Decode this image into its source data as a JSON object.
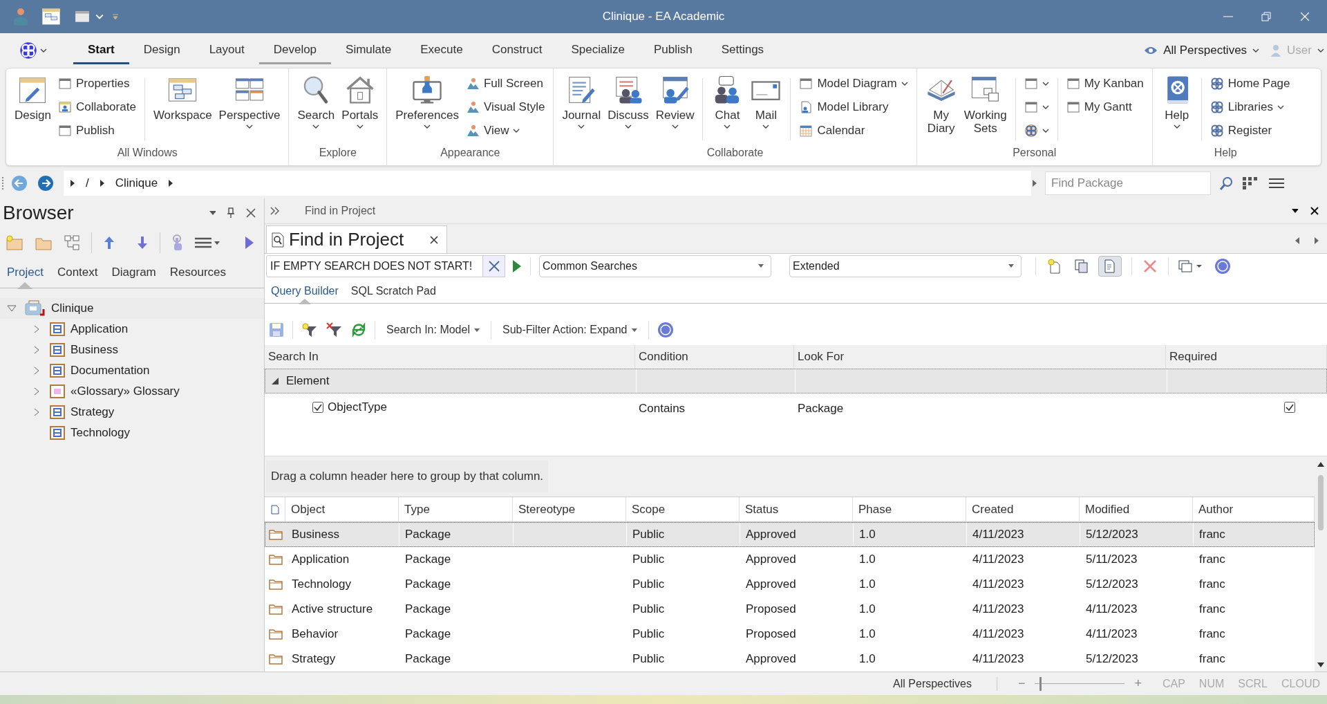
{
  "window": {
    "title": "Clinique - EA Academic"
  },
  "ribbon_tabs": [
    {
      "label": "Start",
      "selected": true,
      "underlined": true
    },
    {
      "label": "Design",
      "selected": false,
      "underlined": false
    },
    {
      "label": "Layout",
      "selected": false,
      "underlined": false
    },
    {
      "label": "Develop",
      "selected": false,
      "underlined": true
    },
    {
      "label": "Simulate",
      "selected": false,
      "underlined": false
    },
    {
      "label": "Execute",
      "selected": false,
      "underlined": false
    },
    {
      "label": "Construct",
      "selected": false,
      "underlined": false
    },
    {
      "label": "Specialize",
      "selected": false,
      "underlined": false
    },
    {
      "label": "Publish",
      "selected": false,
      "underlined": false
    },
    {
      "label": "Settings",
      "selected": false,
      "underlined": false
    }
  ],
  "perspective": {
    "label": "All Perspectives"
  },
  "user": {
    "label": "User",
    "disabled": true
  },
  "ribbon_groups": [
    {
      "label": "All Windows",
      "items": [
        {
          "kind": "large",
          "label": "Design",
          "dropdown": false
        },
        {
          "kind": "stack",
          "items": [
            {
              "label": "Properties",
              "dropdown": false
            },
            {
              "label": "Collaborate",
              "dropdown": false
            },
            {
              "label": "Publish",
              "dropdown": false
            }
          ]
        },
        {
          "kind": "separator"
        },
        {
          "kind": "large",
          "label": "Workspace",
          "dropdown": false
        },
        {
          "kind": "large",
          "label": "Perspective",
          "dropdown": true
        }
      ]
    },
    {
      "label": "Explore",
      "items": [
        {
          "kind": "large",
          "label": "Search",
          "dropdown": true
        },
        {
          "kind": "large",
          "label": "Portals",
          "dropdown": true
        }
      ]
    },
    {
      "label": "Appearance",
      "items": [
        {
          "kind": "large",
          "label": "Preferences",
          "dropdown": true
        },
        {
          "kind": "stack",
          "items": [
            {
              "label": "Full Screen",
              "dropdown": false
            },
            {
              "label": "Visual Style",
              "dropdown": false
            },
            {
              "label": "View",
              "dropdown": true
            }
          ]
        }
      ]
    },
    {
      "label": "Collaborate",
      "items": [
        {
          "kind": "large",
          "label": "Journal",
          "dropdown": true
        },
        {
          "kind": "large",
          "label": "Discuss",
          "dropdown": true
        },
        {
          "kind": "large",
          "label": "Review",
          "dropdown": true
        },
        {
          "kind": "separator"
        },
        {
          "kind": "large",
          "label": "Chat",
          "dropdown": true
        },
        {
          "kind": "large",
          "label": "Mail",
          "dropdown": true
        },
        {
          "kind": "separator"
        },
        {
          "kind": "stack",
          "items": [
            {
              "label": "Model Diagram",
              "dropdown": true
            },
            {
              "label": "Model Library",
              "dropdown": false
            },
            {
              "label": "Calendar",
              "dropdown": false
            }
          ]
        }
      ]
    },
    {
      "label": "Personal",
      "items": [
        {
          "kind": "large",
          "label": "My Diary",
          "dropdown": false
        },
        {
          "kind": "large",
          "label": "Working Sets",
          "dropdown": false
        },
        {
          "kind": "separator"
        },
        {
          "kind": "stack",
          "items": [
            {
              "dropdown": true
            },
            {
              "dropdown": true
            },
            {
              "dropdown": true
            }
          ]
        },
        {
          "kind": "separator"
        },
        {
          "kind": "stack",
          "items": [
            {
              "label": "My Kanban",
              "dropdown": false
            },
            {
              "label": "My Gantt",
              "dropdown": false
            }
          ]
        }
      ]
    },
    {
      "label": "Help",
      "items": [
        {
          "kind": "large",
          "label": "Help",
          "dropdown": true
        },
        {
          "kind": "separator"
        },
        {
          "kind": "stack",
          "items": [
            {
              "label": "Home Page",
              "dropdown": false
            },
            {
              "label": "Libraries",
              "dropdown": true
            },
            {
              "label": "Register",
              "dropdown": false
            }
          ]
        }
      ]
    }
  ],
  "breadcrumb": [
    "/",
    "Clinique"
  ],
  "find_package": {
    "placeholder": "Find Package"
  },
  "browser": {
    "title": "Browser",
    "tabs": [
      {
        "label": "Project",
        "selected": true
      },
      {
        "label": "Context",
        "selected": false
      },
      {
        "label": "Diagram",
        "selected": false
      },
      {
        "label": "Resources",
        "selected": false
      }
    ],
    "tree": [
      {
        "label": "Clinique",
        "kind": "model",
        "expanded": true,
        "children": [
          {
            "label": "Application",
            "kind": "package",
            "expandable": true
          },
          {
            "label": "Business",
            "kind": "package",
            "expandable": true
          },
          {
            "label": "Documentation",
            "kind": "package",
            "expandable": true
          },
          {
            "label": "«Glossary» Glossary",
            "kind": "glossary",
            "expandable": true
          },
          {
            "label": "Strategy",
            "kind": "package",
            "expandable": true
          },
          {
            "label": "Technology",
            "kind": "package",
            "expandable": false
          }
        ]
      }
    ]
  },
  "find_panel": {
    "header": "Find in Project",
    "tab": "Find in Project",
    "search": {
      "value": "IF EMPTY SEARCH DOES NOT START!"
    },
    "common_searches": "Common Searches",
    "search_type": "Extended",
    "subtabs": [
      {
        "label": "Query Builder",
        "selected": true
      },
      {
        "label": "SQL Scratch Pad",
        "selected": false
      }
    ],
    "search_in": "Search In: Model",
    "sub_filter": "Sub-Filter Action: Expand",
    "query": {
      "columns": [
        "Search In",
        "Condition",
        "Look For",
        "Required"
      ],
      "groups": [
        {
          "label": "Element",
          "expanded": true,
          "rows": [
            {
              "field": "ObjectType",
              "checked": true,
              "condition": "Contains",
              "look_for": "Package",
              "required": true
            }
          ]
        }
      ]
    },
    "group_hint": "Drag a column header here to group by that column.",
    "results": {
      "columns": [
        "Object",
        "Type",
        "Stereotype",
        "Scope",
        "Status",
        "Phase",
        "Created",
        "Modified",
        "Author"
      ],
      "rows": [
        {
          "selected": true,
          "cells": [
            "Business",
            "Package",
            "",
            "Public",
            "Approved",
            "1.0",
            "4/11/2023",
            "5/12/2023",
            "franc"
          ]
        },
        {
          "selected": false,
          "cells": [
            "Application",
            "Package",
            "",
            "Public",
            "Approved",
            "1.0",
            "4/11/2023",
            "5/11/2023",
            "franc"
          ]
        },
        {
          "selected": false,
          "cells": [
            "Technology",
            "Package",
            "",
            "Public",
            "Approved",
            "1.0",
            "4/11/2023",
            "5/12/2023",
            "franc"
          ]
        },
        {
          "selected": false,
          "cells": [
            "Active structure",
            "Package",
            "",
            "Public",
            "Proposed",
            "1.0",
            "4/11/2023",
            "4/11/2023",
            "franc"
          ]
        },
        {
          "selected": false,
          "cells": [
            "Behavior",
            "Package",
            "",
            "Public",
            "Proposed",
            "1.0",
            "4/11/2023",
            "4/11/2023",
            "franc"
          ]
        },
        {
          "selected": false,
          "cells": [
            "Strategy",
            "Package",
            "",
            "Public",
            "Approved",
            "1.0",
            "4/11/2023",
            "5/12/2023",
            "franc"
          ]
        }
      ]
    }
  },
  "status_bar": {
    "perspective": "All Perspectives",
    "zoom_out": "−",
    "zoom_in": "+",
    "zoom": {
      "level": 0.05
    },
    "indicators": [
      {
        "label": "CAP",
        "on": false
      },
      {
        "label": "NUM",
        "on": false
      },
      {
        "label": "SCRL",
        "on": false
      },
      {
        "label": "CLOUD",
        "on": false
      }
    ]
  }
}
